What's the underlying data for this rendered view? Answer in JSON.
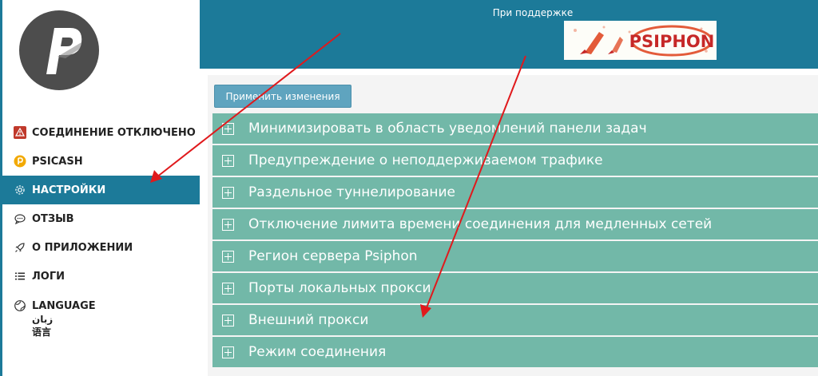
{
  "sidebar": {
    "items": [
      {
        "label": "СОЕДИНЕНИЕ ОТКЛЮЧЕНО",
        "icon": "warning-icon"
      },
      {
        "label": "PSICASH",
        "icon": "psicash-coin-icon"
      },
      {
        "label": "НАСТРОЙКИ",
        "icon": "gear-icon"
      },
      {
        "label": "ОТЗЫВ",
        "icon": "chat-icon"
      },
      {
        "label": "О ПРИЛОЖЕНИИ",
        "icon": "rocket-icon"
      },
      {
        "label": "ЛОГИ",
        "icon": "list-icon"
      },
      {
        "label": "LANGUAGE",
        "icon": "globe-icon",
        "sub": [
          "زبان",
          "语言"
        ]
      }
    ]
  },
  "header": {
    "sponsor_label": "При поддержке",
    "sponsor_logo_text": "PSIPHON"
  },
  "content": {
    "apply_label": "Применить изменения",
    "settings": [
      "Минимизировать в область уведомлений панели задач",
      "Предупреждение о неподдерживаемом трафике",
      "Раздельное туннелирование",
      "Отключение лимита времени соединения для медленных сетей",
      "Регион сервера Psiphon",
      "Порты локальных прокси",
      "Внешний прокси",
      "Режим соединения"
    ]
  },
  "colors": {
    "brand": "#1c7a99",
    "row": "#72b8a8",
    "button": "#5fa4bf",
    "annotation": "#e0191c"
  }
}
